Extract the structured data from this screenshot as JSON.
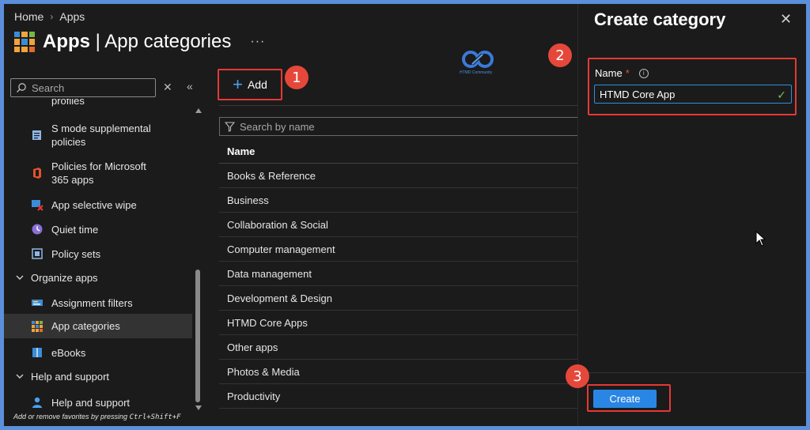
{
  "breadcrumb": {
    "home": "Home",
    "apps": "Apps"
  },
  "page": {
    "title_main": "Apps",
    "title_sep": " | ",
    "title_sub": "App categories",
    "more": "···"
  },
  "sidebar": {
    "search_placeholder": "Search",
    "nav_items": [
      {
        "label": "profiles",
        "icon": "profile-icon"
      },
      {
        "label": "S mode supplemental policies",
        "icon": "policy-doc-icon"
      },
      {
        "label": "Policies for Microsoft 365 apps",
        "icon": "office-icon"
      },
      {
        "label": "App selective wipe",
        "icon": "wipe-icon"
      },
      {
        "label": "Quiet time",
        "icon": "clock-icon"
      },
      {
        "label": "Policy sets",
        "icon": "policy-sets-icon"
      },
      {
        "label": "Organize apps",
        "icon": "chevron-down-icon",
        "group": true
      },
      {
        "label": "Assignment filters",
        "icon": "filter-icon"
      },
      {
        "label": "App categories",
        "icon": "app-grid-icon",
        "active": true
      },
      {
        "label": "eBooks",
        "icon": "book-icon"
      },
      {
        "label": "Help and support",
        "icon": "chevron-down-icon",
        "group": true
      },
      {
        "label": "Help and support",
        "icon": "person-icon"
      }
    ],
    "footer_hint": "Add or remove favorites by pressing ",
    "footer_keys": "Ctrl+Shift+F"
  },
  "toolbar": {
    "add_label": "Add"
  },
  "logo": {
    "text": "HTMD Community"
  },
  "filter": {
    "placeholder": "Search by name"
  },
  "table": {
    "header": "Name",
    "rows": [
      "Books & Reference",
      "Business",
      "Collaboration & Social",
      "Computer management",
      "Data management",
      "Development & Design",
      "HTMD Core Apps",
      "Other apps",
      "Photos & Media",
      "Productivity"
    ]
  },
  "panel": {
    "title": "Create category",
    "name_label": "Name",
    "required_mark": "*",
    "name_value": "HTMD Core App",
    "create_label": "Create"
  },
  "badges": [
    "1",
    "2",
    "3"
  ],
  "colors": {
    "accent": "#2a86e4",
    "highlight": "#e53935",
    "badge": "#e5483a"
  }
}
